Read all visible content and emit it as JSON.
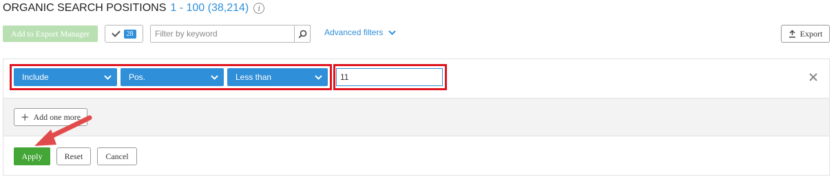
{
  "header": {
    "title": "ORGANIC SEARCH POSITIONS",
    "range": "1 - 100 (38,214)",
    "info_icon": "info-icon"
  },
  "toolbar": {
    "export_manager_label": "Add to Export Manager",
    "selected_count": "28",
    "search_placeholder": "Filter by keyword",
    "search_value": "",
    "advanced_filters_label": "Advanced filters",
    "export_label": "Export"
  },
  "filter": {
    "include_select": "Include",
    "field_select": "Pos.",
    "operator_select": "Less than",
    "value": "11",
    "add_more_label": "Add one more",
    "apply_label": "Apply",
    "reset_label": "Reset",
    "cancel_label": "Cancel"
  },
  "colors": {
    "accent_blue": "#2f8fd9",
    "apply_green": "#44a637",
    "disabled_green": "#b9e0b2",
    "highlight_red": "#e0141e",
    "annotation_arrow": "#e24b4b"
  }
}
